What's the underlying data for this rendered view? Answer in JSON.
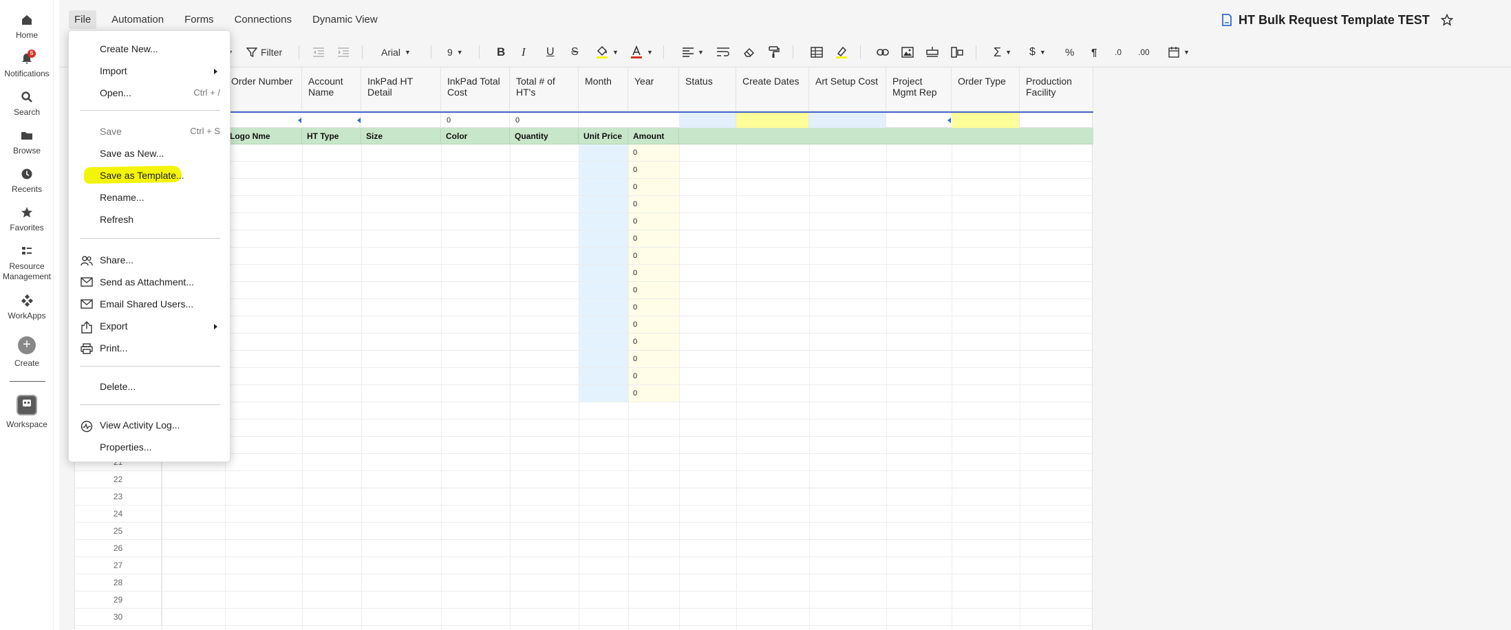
{
  "nav": {
    "home": "Home",
    "notifications": "Notifications",
    "notifications_badge": "5",
    "search": "Search",
    "browse": "Browse",
    "recents": "Recents",
    "favorites": "Favorites",
    "resource_line1": "Resource",
    "resource_line2": "Management",
    "workapps": "WorkApps",
    "create": "Create",
    "workspace": "Workspace"
  },
  "menubar": {
    "file": "File",
    "automation": "Automation",
    "forms": "Forms",
    "connections": "Connections",
    "dynamic_view": "Dynamic View"
  },
  "document": {
    "title": "HT Bulk Request Template TEST"
  },
  "toolbar": {
    "filter": "Filter",
    "font": "Arial",
    "font_size": "9",
    "bold": "B",
    "italic": "I",
    "underline": "U",
    "strike": "S",
    "sum": "Σ",
    "currency": "$",
    "percent": "%",
    "para": "¶",
    "dec_less": ".0",
    "dec_more": ".00"
  },
  "columns": [
    {
      "label": "Order Number"
    },
    {
      "label": "Account Name"
    },
    {
      "label": "InkPad HT Detail"
    },
    {
      "label": "InkPad Total Cost"
    },
    {
      "label": "Total # of HT's"
    },
    {
      "label": "Month"
    },
    {
      "label": "Year"
    },
    {
      "label": "Status"
    },
    {
      "label": "Create Dates"
    },
    {
      "label": "Art Setup Cost"
    },
    {
      "label": "Project Mgmt Rep"
    },
    {
      "label": "Order Type"
    },
    {
      "label": "Production Facility"
    }
  ],
  "summary_values": {
    "total_cost": "0",
    "total_hts": "0"
  },
  "sub_headers": [
    "Logo Nme",
    "HT Type",
    "Size",
    "Color",
    "Quantity",
    "Unit Price",
    "Amount"
  ],
  "amount_values": [
    "0",
    "0",
    "0",
    "0",
    "0",
    "0",
    "0",
    "0",
    "0",
    "0",
    "0",
    "0",
    "0",
    "0",
    "0"
  ],
  "row_numbers": [
    "21",
    "22",
    "23",
    "24",
    "25",
    "26",
    "27",
    "28",
    "29",
    "30"
  ],
  "file_menu": {
    "create_new": "Create New...",
    "import": "Import",
    "open": "Open...",
    "open_shortcut": "Ctrl + /",
    "save": "Save",
    "save_shortcut": "Ctrl + S",
    "save_as_new": "Save as New...",
    "save_as_template": "Save as Template...",
    "rename": "Rename...",
    "refresh": "Refresh",
    "share": "Share...",
    "send_attachment": "Send as Attachment...",
    "email_shared": "Email Shared Users...",
    "export": "Export",
    "print": "Print...",
    "delete": "Delete...",
    "activity_log": "View Activity Log...",
    "properties": "Properties..."
  },
  "colors": {
    "highlight": "#f4f40a",
    "green_band": "#c8e6c9",
    "yellow_cell": "#fdfd9a",
    "blue_cell": "#e3f0fb",
    "amount_band": "#fffde7",
    "unit_price_band": "#e3f2fd",
    "accent_blue": "#4a66c9"
  },
  "icons": {
    "home": "home-icon",
    "notifications": "bell-icon",
    "search": "search-icon",
    "browse": "folder-icon",
    "recents": "clock-icon",
    "favorites": "star-icon",
    "resource": "people-icon",
    "workapps": "workapps-icon",
    "create": "plus-icon",
    "workspace": "workspace-icon"
  }
}
